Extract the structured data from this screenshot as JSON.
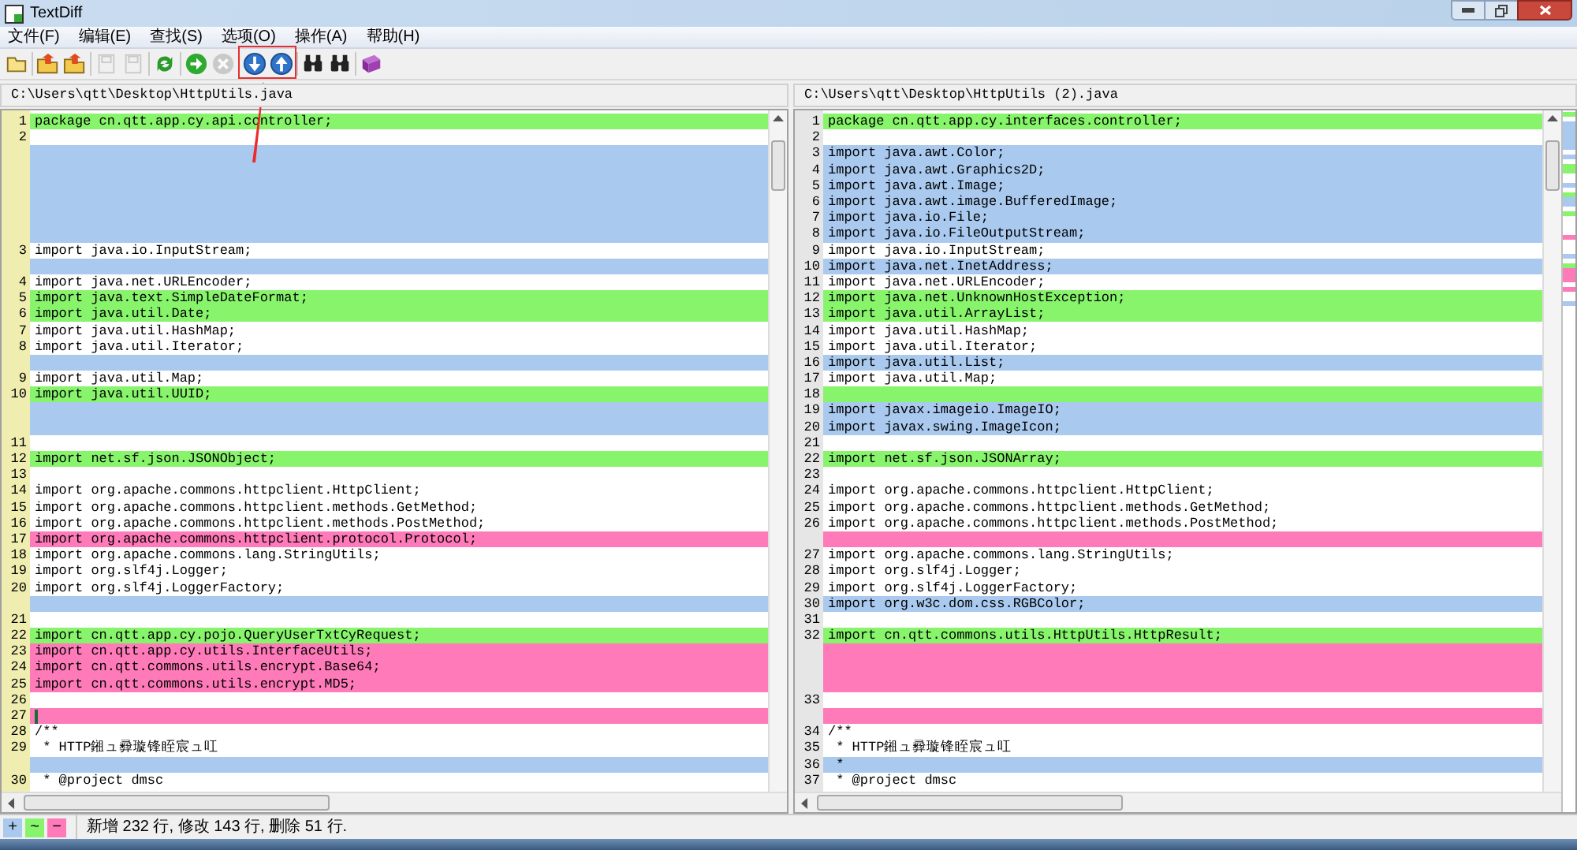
{
  "window": {
    "title": "TextDiff"
  },
  "menu": [
    {
      "label": "文件(F)"
    },
    {
      "label": "编辑(E)"
    },
    {
      "label": "查找(S)"
    },
    {
      "label": "选项(O)"
    },
    {
      "label": "操作(A)"
    },
    {
      "label": "帮助(H)"
    }
  ],
  "toolbar": [
    {
      "kind": "new",
      "disabled": false
    },
    {
      "kind": "sep"
    },
    {
      "kind": "open",
      "disabled": false
    },
    {
      "kind": "open",
      "disabled": false
    },
    {
      "kind": "sep"
    },
    {
      "kind": "save",
      "disabled": true
    },
    {
      "kind": "save",
      "disabled": true
    },
    {
      "kind": "sep"
    },
    {
      "kind": "refresh",
      "disabled": false
    },
    {
      "kind": "sep"
    },
    {
      "kind": "go",
      "disabled": false
    },
    {
      "kind": "stop",
      "disabled": true
    },
    {
      "kind": "sep"
    },
    {
      "kind": "down",
      "disabled": false
    },
    {
      "kind": "up",
      "disabled": false
    },
    {
      "kind": "sep"
    },
    {
      "kind": "find",
      "disabled": false
    },
    {
      "kind": "find",
      "disabled": false
    },
    {
      "kind": "sep"
    },
    {
      "kind": "help",
      "disabled": false
    }
  ],
  "panes": [
    {
      "path": "C:\\Users\\qtt\\Desktop\\HttpUtils.java",
      "focused": true,
      "rows": [
        {
          "num": "1",
          "text": "package cn.qtt.app.cy.api.controller;",
          "kind": "modified"
        },
        {
          "num": "2",
          "kind": "same"
        },
        {
          "kind": "added"
        },
        {
          "kind": "added"
        },
        {
          "kind": "added"
        },
        {
          "kind": "added"
        },
        {
          "kind": "added"
        },
        {
          "kind": "added"
        },
        {
          "num": "3",
          "text": "import java.io.InputStream;",
          "kind": "same"
        },
        {
          "kind": "added"
        },
        {
          "num": "4",
          "text": "import java.net.URLEncoder;",
          "kind": "same"
        },
        {
          "num": "5",
          "text": "import java.text.SimpleDateFormat;",
          "kind": "modified"
        },
        {
          "num": "6",
          "text": "import java.util.Date;",
          "kind": "modified"
        },
        {
          "num": "7",
          "text": "import java.util.HashMap;",
          "kind": "same"
        },
        {
          "num": "8",
          "text": "import java.util.Iterator;",
          "kind": "same"
        },
        {
          "kind": "added"
        },
        {
          "num": "9",
          "text": "import java.util.Map;",
          "kind": "same"
        },
        {
          "num": "10",
          "text": "import java.util.UUID;",
          "kind": "modified"
        },
        {
          "kind": "added"
        },
        {
          "kind": "added"
        },
        {
          "num": "11",
          "kind": "same"
        },
        {
          "num": "12",
          "text": "import net.sf.json.JSONObject;",
          "kind": "modified"
        },
        {
          "num": "13",
          "kind": "same"
        },
        {
          "num": "14",
          "text": "import org.apache.commons.httpclient.HttpClient;",
          "kind": "same"
        },
        {
          "num": "15",
          "text": "import org.apache.commons.httpclient.methods.GetMethod;",
          "kind": "same"
        },
        {
          "num": "16",
          "text": "import org.apache.commons.httpclient.methods.PostMethod;",
          "kind": "same"
        },
        {
          "num": "17",
          "text": "import org.apache.commons.httpclient.protocol.Protocol;",
          "kind": "deleted"
        },
        {
          "num": "18",
          "text": "import org.apache.commons.lang.StringUtils;",
          "kind": "same"
        },
        {
          "num": "19",
          "text": "import org.slf4j.Logger;",
          "kind": "same"
        },
        {
          "num": "20",
          "text": "import org.slf4j.LoggerFactory;",
          "kind": "same"
        },
        {
          "kind": "added"
        },
        {
          "num": "21",
          "kind": "same"
        },
        {
          "num": "22",
          "text": "import cn.qtt.app.cy.pojo.QueryUserTxtCyRequest;",
          "kind": "modified"
        },
        {
          "num": "23",
          "text": "import cn.qtt.app.cy.utils.InterfaceUtils;",
          "kind": "deleted"
        },
        {
          "num": "24",
          "text": "import cn.qtt.commons.utils.encrypt.Base64;",
          "kind": "deleted"
        },
        {
          "num": "25",
          "text": "import cn.qtt.commons.utils.encrypt.MD5;",
          "kind": "deleted"
        },
        {
          "num": "26",
          "kind": "same"
        },
        {
          "num": "27",
          "kind": "deleted",
          "cursor": true
        },
        {
          "num": "28",
          "text": "/**",
          "kind": "same"
        },
        {
          "num": "29",
          "text": " * HTTP鎺ュ彛璇锋眰宸ュ叿",
          "kind": "same"
        },
        {
          "kind": "added"
        },
        {
          "num": "30",
          "text": " * @project dmsc",
          "kind": "same"
        }
      ]
    },
    {
      "path": "C:\\Users\\qtt\\Desktop\\HttpUtils (2).java",
      "focused": false,
      "rows": [
        {
          "num": "1",
          "text": "package cn.qtt.app.cy.interfaces.controller;",
          "kind": "modified"
        },
        {
          "num": "2",
          "kind": "same"
        },
        {
          "num": "3",
          "text": "import java.awt.Color;",
          "kind": "added"
        },
        {
          "num": "4",
          "text": "import java.awt.Graphics2D;",
          "kind": "added"
        },
        {
          "num": "5",
          "text": "import java.awt.Image;",
          "kind": "added"
        },
        {
          "num": "6",
          "text": "import java.awt.image.BufferedImage;",
          "kind": "added"
        },
        {
          "num": "7",
          "text": "import java.io.File;",
          "kind": "added"
        },
        {
          "num": "8",
          "text": "import java.io.FileOutputStream;",
          "kind": "added"
        },
        {
          "num": "9",
          "text": "import java.io.InputStream;",
          "kind": "same"
        },
        {
          "num": "10",
          "text": "import java.net.InetAddress;",
          "kind": "added"
        },
        {
          "num": "11",
          "text": "import java.net.URLEncoder;",
          "kind": "same"
        },
        {
          "num": "12",
          "text": "import java.net.UnknownHostException;",
          "kind": "modified"
        },
        {
          "num": "13",
          "text": "import java.util.ArrayList;",
          "kind": "modified"
        },
        {
          "num": "14",
          "text": "import java.util.HashMap;",
          "kind": "same"
        },
        {
          "num": "15",
          "text": "import java.util.Iterator;",
          "kind": "same"
        },
        {
          "num": "16",
          "text": "import java.util.List;",
          "kind": "added"
        },
        {
          "num": "17",
          "text": "import java.util.Map;",
          "kind": "same"
        },
        {
          "num": "18",
          "kind": "modified"
        },
        {
          "num": "19",
          "text": "import javax.imageio.ImageIO;",
          "kind": "added"
        },
        {
          "num": "20",
          "text": "import javax.swing.ImageIcon;",
          "kind": "added"
        },
        {
          "num": "21",
          "kind": "same"
        },
        {
          "num": "22",
          "text": "import net.sf.json.JSONArray;",
          "kind": "modified"
        },
        {
          "num": "23",
          "kind": "same"
        },
        {
          "num": "24",
          "text": "import org.apache.commons.httpclient.HttpClient;",
          "kind": "same"
        },
        {
          "num": "25",
          "text": "import org.apache.commons.httpclient.methods.GetMethod;",
          "kind": "same"
        },
        {
          "num": "26",
          "text": "import org.apache.commons.httpclient.methods.PostMethod;",
          "kind": "same"
        },
        {
          "kind": "deleted"
        },
        {
          "num": "27",
          "text": "import org.apache.commons.lang.StringUtils;",
          "kind": "same"
        },
        {
          "num": "28",
          "text": "import org.slf4j.Logger;",
          "kind": "same"
        },
        {
          "num": "29",
          "text": "import org.slf4j.LoggerFactory;",
          "kind": "same"
        },
        {
          "num": "30",
          "text": "import org.w3c.dom.css.RGBColor;",
          "kind": "added"
        },
        {
          "num": "31",
          "kind": "same"
        },
        {
          "num": "32",
          "text": "import cn.qtt.commons.utils.HttpUtils.HttpResult;",
          "kind": "modified"
        },
        {
          "kind": "deleted"
        },
        {
          "kind": "deleted"
        },
        {
          "kind": "deleted"
        },
        {
          "num": "33",
          "kind": "same"
        },
        {
          "kind": "deleted"
        },
        {
          "num": "34",
          "text": "/**",
          "kind": "same"
        },
        {
          "num": "35",
          "text": " * HTTP鎺ュ彛璇锋眰宸ュ叿",
          "kind": "same"
        },
        {
          "num": "36",
          "text": " *",
          "kind": "added"
        },
        {
          "num": "37",
          "text": " * @project dmsc",
          "kind": "same"
        }
      ]
    }
  ],
  "legend": [
    {
      "symbol": "+",
      "kind": "added"
    },
    {
      "symbol": "~",
      "kind": "modified"
    },
    {
      "symbol": "−",
      "kind": "deleted"
    }
  ],
  "status_bar": {
    "text": "新增 232 行, 修改 143 行, 删除 51 行."
  }
}
